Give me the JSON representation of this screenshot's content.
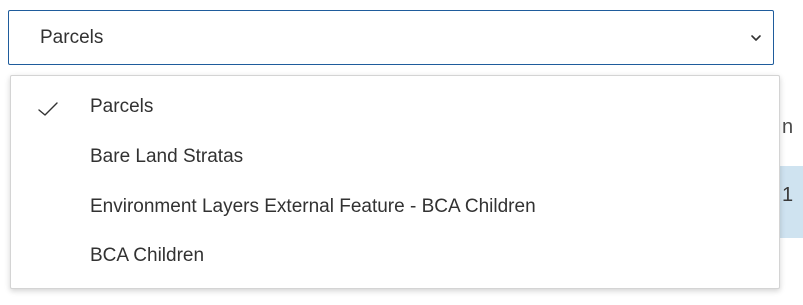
{
  "select": {
    "value": "Parcels",
    "icon": "chevron-down-icon",
    "border_color": "#1f5c9c"
  },
  "dropdown": {
    "options": [
      {
        "label": "Parcels",
        "selected": true
      },
      {
        "label": "Bare Land Stratas",
        "selected": false
      },
      {
        "label": "Environment Layers External Feature - BCA Children",
        "selected": false
      },
      {
        "label": "BCA Children",
        "selected": false
      }
    ],
    "check_icon": "checkmark-icon"
  },
  "background": {
    "partial_text_top": "n",
    "partial_text_row": "1",
    "row_highlight_color": "#cfe3f0"
  }
}
